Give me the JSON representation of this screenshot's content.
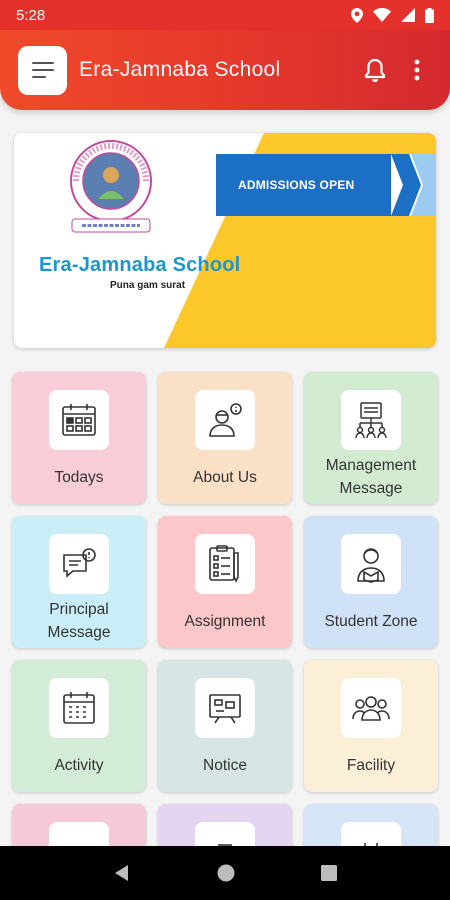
{
  "status_bar": {
    "time": "5:28"
  },
  "app_bar": {
    "title": "Era-Jamnaba School"
  },
  "banner": {
    "admissions": "ADMISSIONS OPEN",
    "school_name": "Era-Jamnaba School",
    "location": "Puna gam surat"
  },
  "tiles": [
    {
      "label": "Todays",
      "bg": "#f8cdd7"
    },
    {
      "label": "About Us",
      "bg": "#fbe0c8"
    },
    {
      "label": "Management\nMessage",
      "bg": "#d3ebd1"
    },
    {
      "label": "Principal\nMessage",
      "bg": "#c9eef7"
    },
    {
      "label": "Assignment",
      "bg": "#fbc7c8"
    },
    {
      "label": "Student Zone",
      "bg": "#cfe2f7"
    },
    {
      "label": "Activity",
      "bg": "#d3ecd8"
    },
    {
      "label": "Notice",
      "bg": "#d7e6e4"
    },
    {
      "label": "Facility",
      "bg": "#fbf0d7"
    },
    {
      "label": "",
      "bg": "#f6c9d9"
    },
    {
      "label": "",
      "bg": "#e3d5f1"
    },
    {
      "label": "",
      "bg": "#d5e4f7"
    }
  ],
  "colors": {
    "app_bar": "#e5312b",
    "banner_yellow": "#fcc72a",
    "banner_blue": "#1b6fc4",
    "school_name": "#1d96c9"
  }
}
